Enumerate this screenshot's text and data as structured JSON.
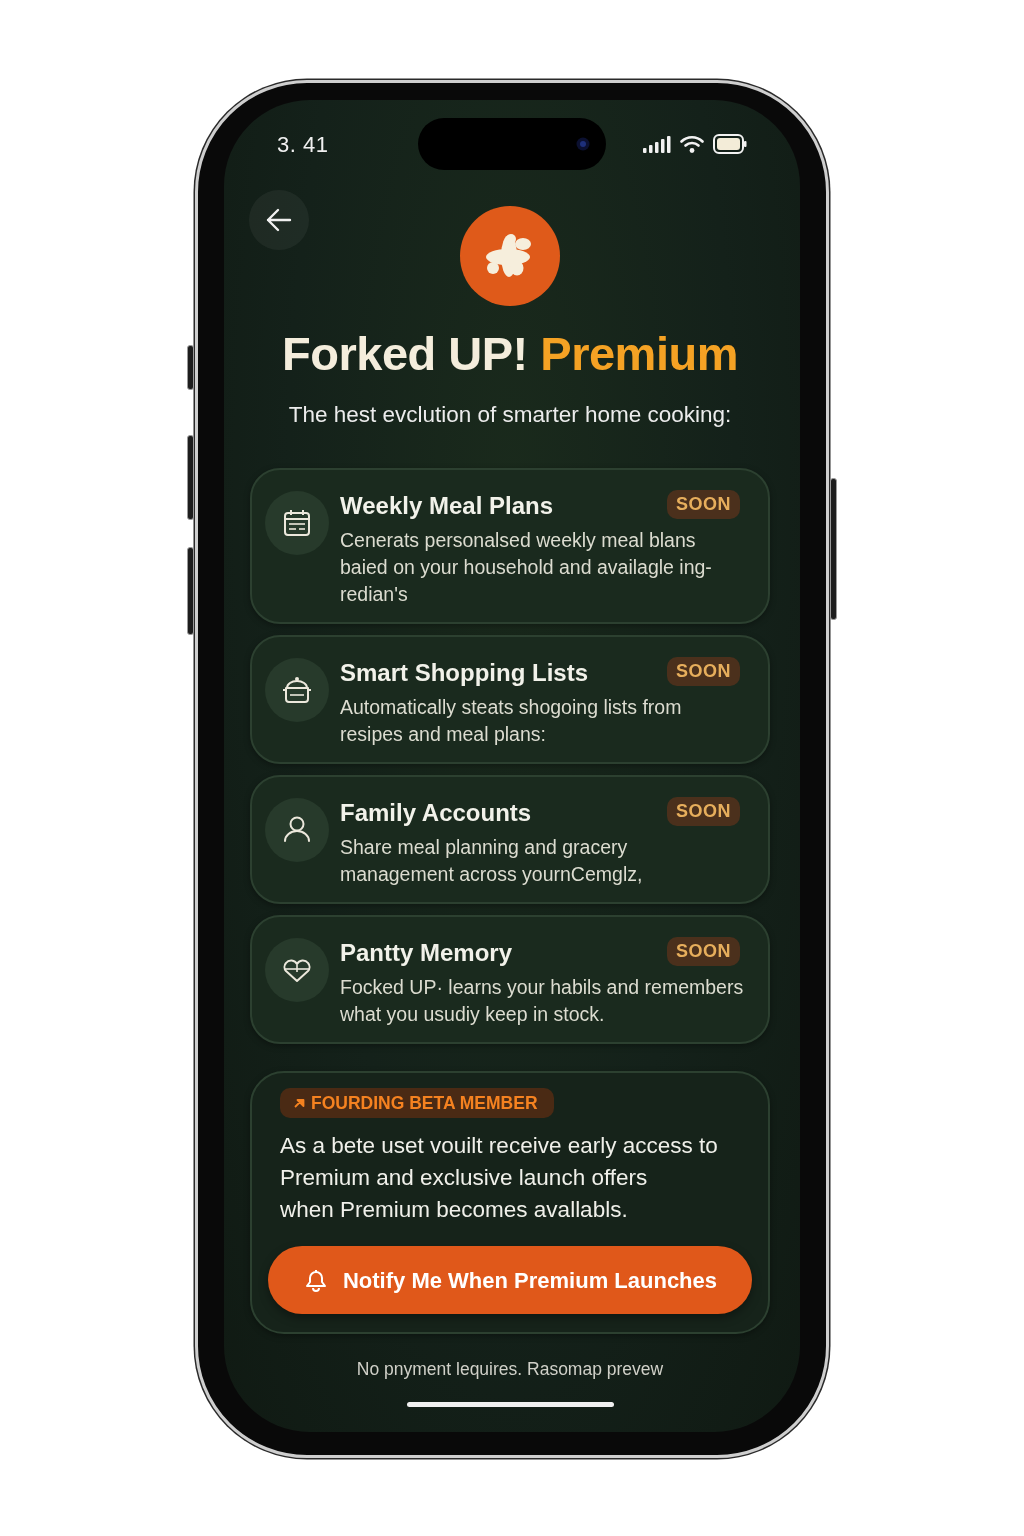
{
  "status_bar": {
    "time": "3. 41"
  },
  "header": {
    "title": "Forked UP!",
    "title_highlight": "Premium",
    "subtitle": "The hest evclution of smarter home cooking:"
  },
  "features": [
    {
      "title": "Weekly Meal Plans",
      "badge": "SOON",
      "description": "Cenerats personalsed weekly meal blans\nbaied on your household and availagle ing-\nredian's"
    },
    {
      "title": "Smart Shopping Lists",
      "badge": "SOON",
      "description": "Automatically steats shogoing lists from\nresipes and meal plans:"
    },
    {
      "title": "Family Accounts",
      "badge": "SOON",
      "description": "Share meal planning and gracery\nmanagement across yournCemglz,"
    },
    {
      "title": "Pantty Memory",
      "badge": "SOON",
      "description": "Focked UP· learns your habils and remembers\nwhat you usudiy keep in stock."
    }
  ],
  "beta": {
    "badge": "FOURDING BETA MEMBER",
    "text": "As a bete uset vouilt receive early access to\nPremium and exclusive launch offers\nwhen Premium becomes avallabls.",
    "button": "Notify Me When Premium Launches"
  },
  "footer": "No pnyment lequires. Rasomap prevew"
}
